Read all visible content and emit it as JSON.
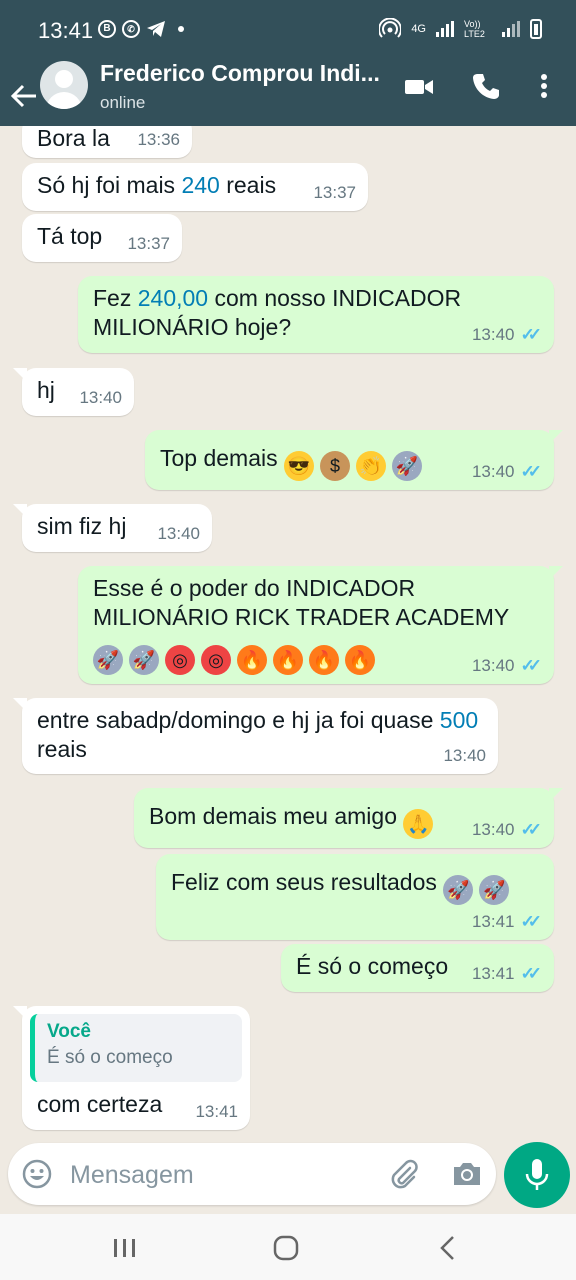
{
  "status_bar": {
    "time": "13:41",
    "network_type": "4G",
    "volte": "Vo)) LTE2"
  },
  "header": {
    "contact_name": "Frederico Comprou Indi...",
    "status": "online"
  },
  "messages": [
    {
      "dir": "in",
      "time": "13:36",
      "parts": [
        {
          "t": "Bora la"
        }
      ]
    },
    {
      "dir": "in",
      "time": "13:37",
      "parts": [
        {
          "t": "Só hj foi mais "
        },
        {
          "t": "240",
          "num": true
        },
        {
          "t": " reais"
        }
      ]
    },
    {
      "dir": "in",
      "time": "13:37",
      "parts": [
        {
          "t": "Tá top"
        }
      ]
    },
    {
      "dir": "out",
      "time": "13:40",
      "parts": [
        {
          "t": "Fez "
        },
        {
          "t": "240,00",
          "num": true
        },
        {
          "t": " com nosso INDICADOR MILIONÁRIO hoje?"
        }
      ]
    },
    {
      "dir": "in",
      "time": "13:40",
      "parts": [
        {
          "t": "hj"
        }
      ]
    },
    {
      "dir": "out",
      "time": "13:40",
      "parts": [
        {
          "t": "Top demais "
        }
      ],
      "emojis": [
        "sunglasses-emoji",
        "money-bag-emoji",
        "clapping-hands-emoji",
        "rocket-emoji"
      ]
    },
    {
      "dir": "in",
      "time": "13:40",
      "parts": [
        {
          "t": "sim fiz hj"
        }
      ]
    },
    {
      "dir": "out",
      "time": "13:40",
      "parts": [
        {
          "t": "Esse é o poder do INDICADOR MILIONÁRIO RICK TRADER ACADEMY"
        }
      ],
      "emojis": [
        "rocket-emoji",
        "rocket-emoji",
        "target-emoji",
        "target-emoji",
        "fire-emoji",
        "fire-emoji",
        "fire-emoji",
        "fire-emoji"
      ]
    },
    {
      "dir": "in",
      "time": "13:40",
      "parts": [
        {
          "t": "entre sabadp/domingo e hj ja foi quase "
        },
        {
          "t": "500",
          "num": true
        },
        {
          "t": " reais"
        }
      ]
    },
    {
      "dir": "out",
      "time": "13:40",
      "parts": [
        {
          "t": "Bom demais meu amigo "
        }
      ],
      "emojis": [
        "folded-hands-emoji"
      ]
    },
    {
      "dir": "out",
      "time": "13:41",
      "parts": [
        {
          "t": "Feliz com seus resultados "
        }
      ],
      "emojis": [
        "rocket-emoji",
        "rocket-emoji"
      ]
    },
    {
      "dir": "out",
      "time": "13:41",
      "parts": [
        {
          "t": "É só o começo"
        }
      ]
    },
    {
      "dir": "in",
      "time": "13:41",
      "quote": {
        "author": "Você",
        "text": "É só o começo"
      },
      "parts": [
        {
          "t": "com certeza"
        }
      ]
    }
  ],
  "input": {
    "placeholder": "Mensagem"
  },
  "colors": {
    "header": "#33505a",
    "chat_bg": "#efeae2",
    "outgoing": "#d9fdd3",
    "incoming": "#ffffff",
    "accent": "#00a884",
    "read_ticks": "#53bdeb",
    "number_link": "#027eb5"
  }
}
